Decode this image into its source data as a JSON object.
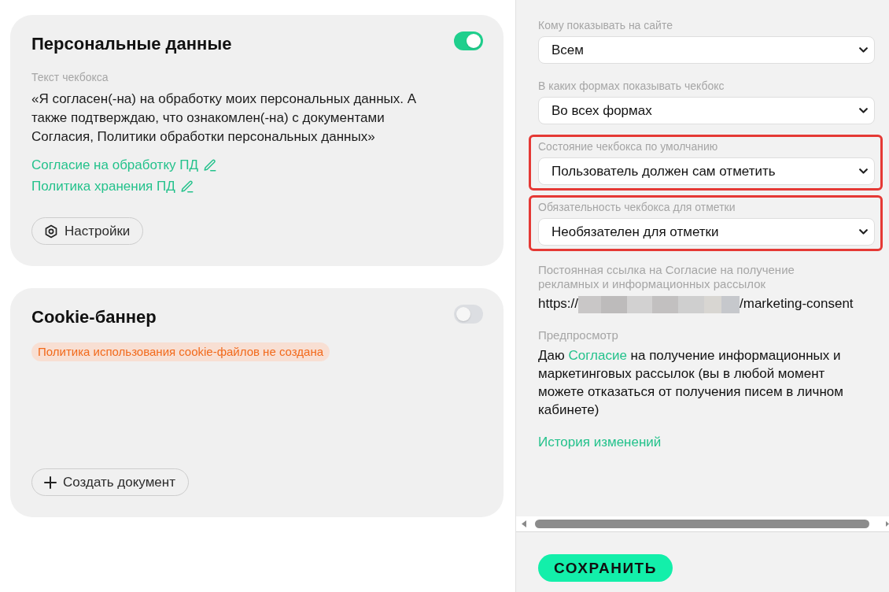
{
  "cards": [
    {
      "title": "Персональные данные",
      "enabled": true,
      "field_label": "Текст чекбокса",
      "text": "«Я согласен(-на) на обработку моих персональных данных. А также подтверждаю, что ознакомлен(-на) с документами Согласия, Политики обработки персональных данных»",
      "links": [
        {
          "label": "Согласие на обработку ПД"
        },
        {
          "label": "Политика хранения ПД"
        }
      ],
      "button": {
        "kind": "settings",
        "label": "Настройки"
      }
    },
    {
      "title": "Cookie-баннер",
      "enabled": false,
      "warning": "Политика использования cookie-файлов не создана",
      "button": {
        "kind": "create",
        "label": "Создать документ"
      }
    }
  ],
  "settings": {
    "fields": [
      {
        "label": "Кому показывать на сайте",
        "value": "Всем",
        "highlighted": false
      },
      {
        "label": "В каких формах показывать чекбокс",
        "value": "Во всех формах",
        "highlighted": false
      },
      {
        "label": "Состояние чекбокса по умолчанию",
        "value": "Пользователь должен сам отметить",
        "highlighted": true
      },
      {
        "label": "Обязательность чекбокса для отметки",
        "value": "Необязателен для отметки",
        "highlighted": true
      }
    ],
    "permalink": {
      "label": "Постоянная ссылка на Согласие на получение рекламных и информационных рассылок",
      "prefix": "https://",
      "redacted": true,
      "suffix": "/marketing-consent"
    },
    "preview": {
      "label": "Предпросмотр",
      "before": "Даю",
      "link": "Согласие",
      "after": "на получение информационных и маркетинговых рассылок (вы в любой момент можете отказаться от получения писем в личном кабинете)"
    },
    "history_link": "История изменений"
  },
  "save_button": "СОХРАНИТЬ"
}
